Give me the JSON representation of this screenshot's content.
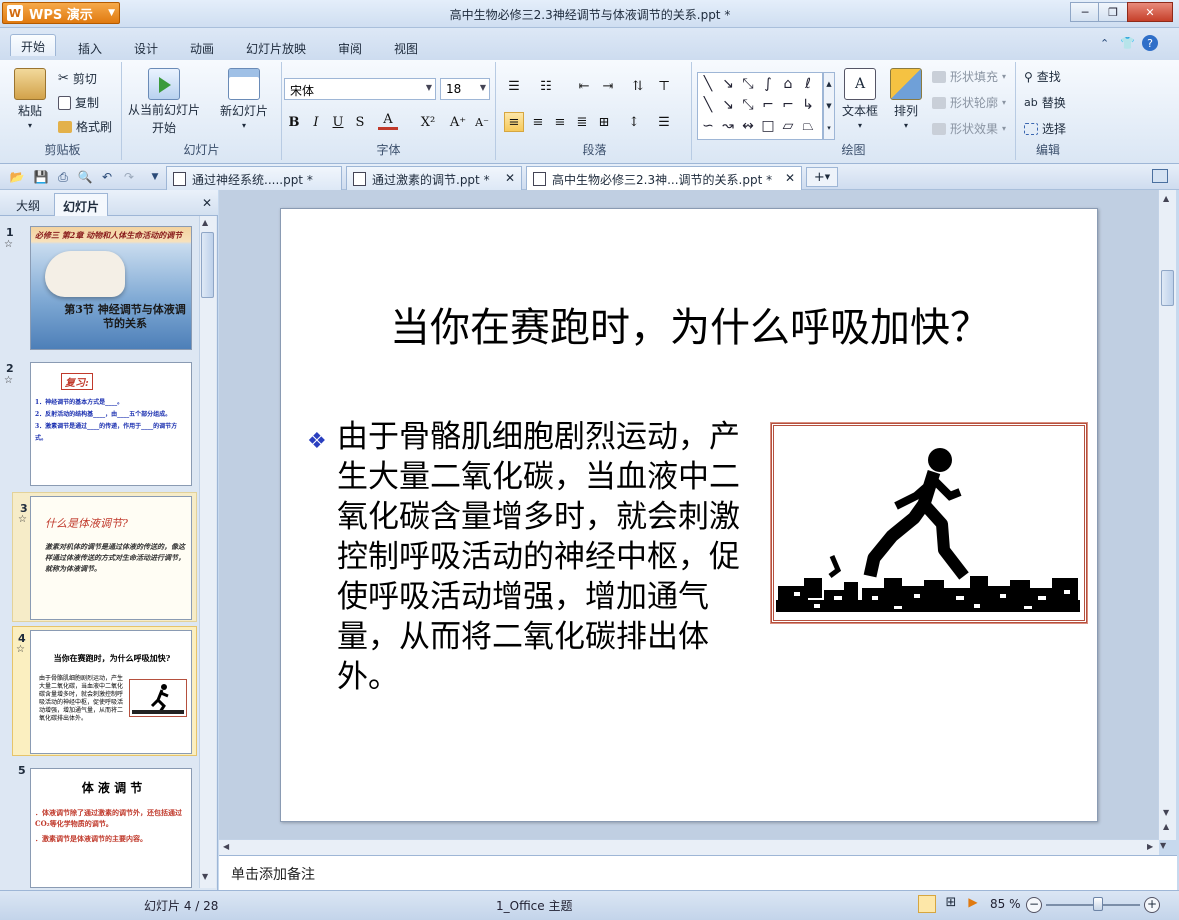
{
  "app": {
    "name": "WPS 演示",
    "logo": "W",
    "window_title": "高中生物必修三2.3神经调节与体液调节的关系.ppt *"
  },
  "window_controls": {
    "minimize": "─",
    "restore": "❐",
    "close": "✕"
  },
  "menu_tabs": [
    "开始",
    "插入",
    "设计",
    "动画",
    "幻灯片放映",
    "审阅",
    "视图"
  ],
  "ribbon": {
    "clipboard": {
      "paste": "粘贴",
      "cut": "剪切",
      "copy": "复制",
      "format_painter": "格式刷",
      "label": "剪贴板"
    },
    "slides": {
      "from_current": "从当前幻灯片",
      "start": "开始",
      "new_slide": "新幻灯片",
      "label": "幻灯片"
    },
    "font": {
      "name": "宋体",
      "size": "18",
      "bold": "B",
      "italic": "I",
      "underline": "U",
      "shadow": "S",
      "color": "A",
      "label": "字体"
    },
    "paragraph": {
      "label": "段落"
    },
    "drawing": {
      "textbox": "文本框",
      "arrange": "排列",
      "shape_fill": "形状填充",
      "shape_outline": "形状轮廓",
      "shape_effect": "形状效果",
      "label": "绘图"
    },
    "edit": {
      "find": "查找",
      "replace": "替换",
      "select": "选择",
      "label": "编辑"
    }
  },
  "doc_tabs": [
    {
      "title": "通过神经系统.....ppt *",
      "active": false
    },
    {
      "title": "通过激素的调节.ppt *",
      "active": false
    },
    {
      "title": "高中生物必修三2.3神...调节的关系.ppt *",
      "active": true
    }
  ],
  "left_panel": {
    "tabs": [
      "大纲",
      "幻灯片"
    ],
    "thumbs": [
      {
        "num": "1",
        "header": "必修三  第2章  动物和人体生命活动的调节",
        "title": "第3节  神经调节与体液调节的关系"
      },
      {
        "num": "2",
        "header": "复习:",
        "lines": [
          "1．神经调节的基本方式是____。",
          "2．反射活动的结构基____，由____五个部分组成。",
          "3．激素调节是通过____的传递，作用于____的调节方式。"
        ]
      },
      {
        "num": "3",
        "header": "什么是体液调节?",
        "body": "激素对机体的调节是通过体液的传送的，像这样通过体液传送的方式对生命活动进行调节，就称为体液调节。"
      },
      {
        "num": "4",
        "header": "当你在赛跑时，为什么呼吸加快?",
        "body": "由于骨骼肌细胞剧烈运动，产生大量二氧化碳，当血液中二氧化碳含量增多时，就会刺激控制呼吸活动的神经中枢，促使呼吸活动增强，增加通气量，从而将二氧化碳排出体外。"
      },
      {
        "num": "5",
        "header": "体 液 调 节",
        "lines": [
          "．体液调节除了通过激素的调节外，还包括通过CO₂等化学物质的调节。",
          "．激素调节是体液调节的主要内容。"
        ]
      }
    ]
  },
  "slide": {
    "title": "当你在赛跑时，为什么呼吸加快？",
    "bullet": "❖",
    "body": "由于骨骼肌细胞剧烈运动，产生大量二氧化碳，当血液中二氧化碳含量增多时，就会刺激控制呼吸活动的神经中枢，促使呼吸活动增强，增加通气量，从而将二氧化碳排出体外。"
  },
  "notes_placeholder": "单击添加备注",
  "status": {
    "slide": "幻灯片 4 / 28",
    "theme": "1_Office 主题",
    "zoom": "85 %",
    "zoom_level": 0.55
  },
  "colors": {
    "accent": "#e07a10",
    "bullet": "#2a3fbf"
  }
}
